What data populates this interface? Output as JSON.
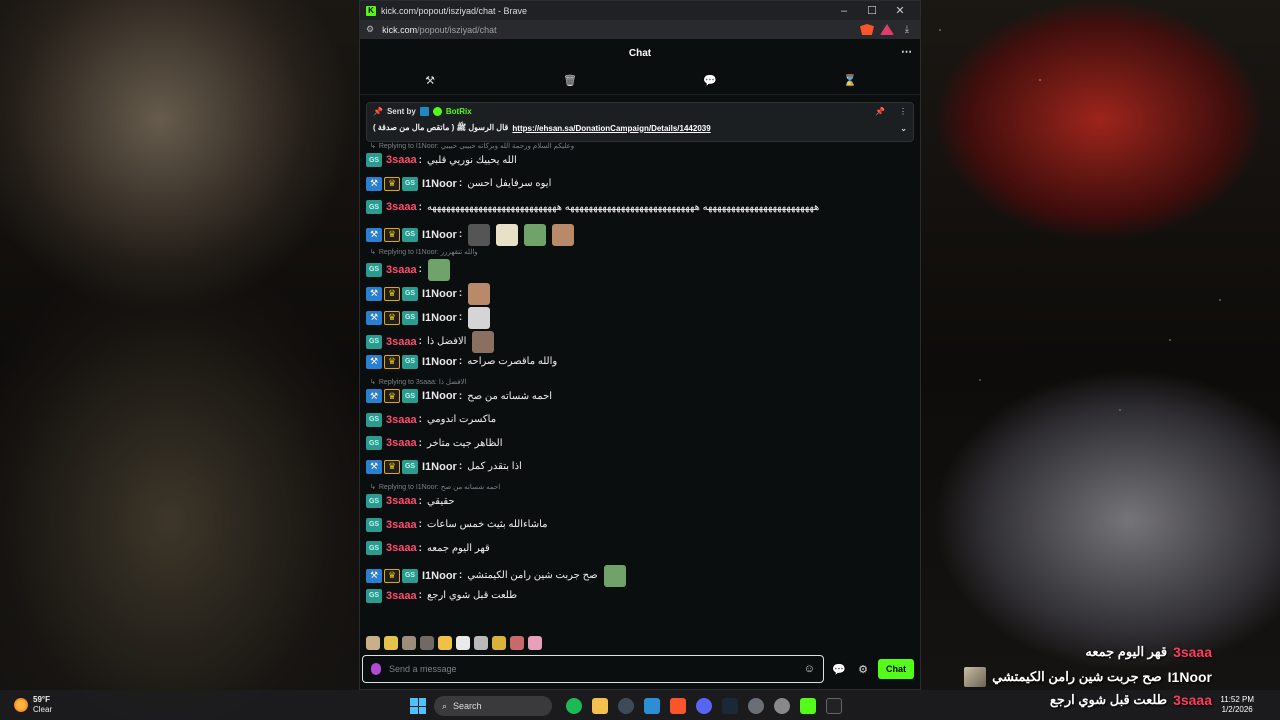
{
  "browser": {
    "window_title": "kick.com/popout/isziyad/chat - Brave",
    "favicon_letter": "K",
    "url_host": "kick.com",
    "url_path": "/popout/isziyad/chat",
    "controls": {
      "minimize": "–",
      "maximize": "☐",
      "close": "✕"
    }
  },
  "chat": {
    "header_title": "Chat",
    "more_icon": "⋯",
    "tools": [
      "hammer-icon",
      "trash-icon",
      "chat-bubble-icon",
      "hourglass-icon"
    ],
    "pinned": {
      "sent_by_label": "Sent by",
      "sender": "BotRix",
      "text": "قال الرسول ﷺ ( ماتقص مال من صدقة )",
      "link": "https://ehsan.sa/DonationCampaign/Details/1442039"
    },
    "messages": [
      {
        "type": "reply",
        "text": "Replying to I1Noor: وعليكم السلام ورحمة الله وبركاته حبيبي حبيبي"
      },
      {
        "user": "3saaa",
        "badges": [
          "gift"
        ],
        "text": "الله يحييك نوريي قلبي"
      },
      {
        "user": "I1Noor",
        "badges": [
          "mod",
          "vip",
          "gift"
        ],
        "text": "ايوه سرفايفل احسن"
      },
      {
        "user": "3saaa",
        "badges": [
          "gift"
        ],
        "text": "ههههههههههههههههههههههههه ههههههههههههههههههههههههههههه ههههههههههههههههههههههههههههه"
      },
      {
        "user": "I1Noor",
        "badges": [
          "mod",
          "vip",
          "gift"
        ],
        "text": "",
        "emotes": 4
      },
      {
        "type": "reply",
        "text": "Replying to I1Noor: والله تتقهررر"
      },
      {
        "user": "3saaa",
        "badges": [
          "gift"
        ],
        "text": "",
        "emotes": 1
      },
      {
        "user": "I1Noor",
        "badges": [
          "mod",
          "vip",
          "gift"
        ],
        "text": "",
        "emotes": 1
      },
      {
        "user": "I1Noor",
        "badges": [
          "mod",
          "vip",
          "gift"
        ],
        "text": "",
        "emotes": 1
      },
      {
        "user": "3saaa",
        "badges": [
          "gift"
        ],
        "text": "الافضل ذا",
        "emotes": 1
      },
      {
        "user": "I1Noor",
        "badges": [
          "mod",
          "vip",
          "gift"
        ],
        "text": "والله ماقصرت صراحه"
      },
      {
        "type": "reply",
        "text": "Replying to 3saaa: الافضل ذا"
      },
      {
        "user": "I1Noor",
        "badges": [
          "mod",
          "vip",
          "gift"
        ],
        "text": "احمه شساته من صح"
      },
      {
        "user": "3saaa",
        "badges": [
          "gift"
        ],
        "text": "ماكسرت اندومي"
      },
      {
        "user": "3saaa",
        "badges": [
          "gift"
        ],
        "text": "الظاهر جيت متاخر"
      },
      {
        "user": "I1Noor",
        "badges": [
          "mod",
          "vip",
          "gift"
        ],
        "text": "اذا بتقدر كمل"
      },
      {
        "type": "reply",
        "text": "Replying to I1Noor: احمه شساته من صح"
      },
      {
        "user": "3saaa",
        "badges": [
          "gift"
        ],
        "text": "حقيقي"
      },
      {
        "user": "3saaa",
        "badges": [
          "gift"
        ],
        "text": "ماشاءالله بثيث خمس ساعات"
      },
      {
        "user": "3saaa",
        "badges": [
          "gift"
        ],
        "text": "قهر اليوم جمعه"
      },
      {
        "user": "I1Noor",
        "badges": [
          "mod",
          "vip",
          "gift"
        ],
        "text": "صح جربت شين رامن الكيمتشي",
        "emotes": 1
      },
      {
        "user": "3saaa",
        "badges": [
          "gift"
        ],
        "text": "طلعت قبل شوي ارجع"
      }
    ],
    "input_placeholder": "Send a message",
    "send_label": "Chat"
  },
  "overlay": [
    {
      "user": "3saaa",
      "text": "قهر اليوم جمعه"
    },
    {
      "user": "I1Noor",
      "text": "صح جربت شين رامن الكيمتشي"
    },
    {
      "user": "3saaa",
      "text": "طلعت قبل شوي ارجع"
    }
  ],
  "taskbar": {
    "temperature": "59°F",
    "condition": "Clear",
    "search_label": "Search",
    "time": "11:52 PM",
    "date": "1/2/2026"
  },
  "colors": {
    "kick_green": "#53fc18",
    "username_3saaa": "#ff4d6d",
    "mod_badge": "#2a7fd0",
    "gift_badge": "#2d9a8f"
  }
}
